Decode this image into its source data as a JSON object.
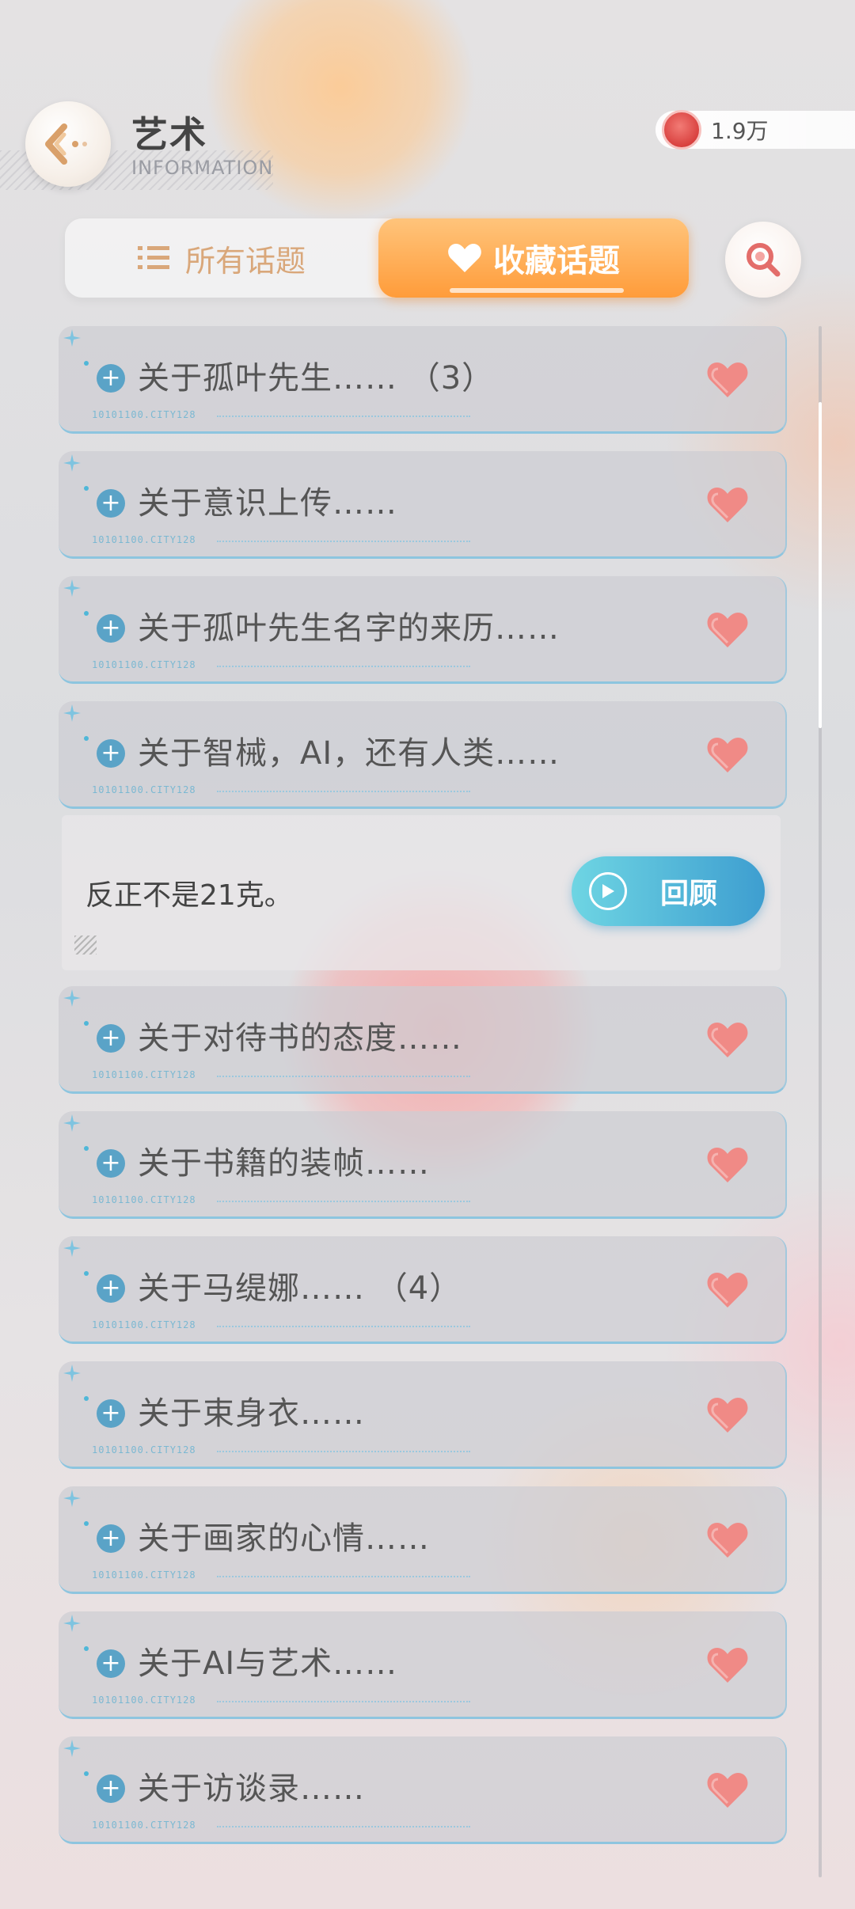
{
  "header": {
    "title": "艺术",
    "subtitle": "INFORMATION",
    "currency_value": "1.9万"
  },
  "tabs": {
    "all_label": "所有话题",
    "favorites_label": "收藏话题",
    "active": "favorites"
  },
  "topics": [
    {
      "label": "关于孤叶先生…… （3）",
      "favorited": true
    },
    {
      "label": "关于意识上传……",
      "favorited": true
    },
    {
      "label": "关于孤叶先生名字的来历……",
      "favorited": true
    },
    {
      "label": "关于智械，AI，还有人类……",
      "favorited": true
    },
    {
      "label": "关于对待书的态度……",
      "favorited": true
    },
    {
      "label": "关于书籍的装帧……",
      "favorited": true
    },
    {
      "label": "关于马缇娜…… （4）",
      "favorited": true
    },
    {
      "label": "关于束身衣……",
      "favorited": true
    },
    {
      "label": "关于画家的心情……",
      "favorited": true
    },
    {
      "label": "关于AI与艺术……",
      "favorited": true
    },
    {
      "label": "关于访谈录……",
      "favorited": true
    }
  ],
  "expanded_answer": {
    "text": "反正不是21克。",
    "review_label": "回顾"
  },
  "card_code": "10101100.CITY128",
  "colors": {
    "accent_orange": "#ff9c3a",
    "heart": "#f08a86",
    "review_button": "#3e9ed0"
  },
  "icons": {
    "back": "back-arrow-icon",
    "search": "search-icon",
    "heart": "heart-icon",
    "list": "list-icon",
    "play": "play-icon"
  }
}
